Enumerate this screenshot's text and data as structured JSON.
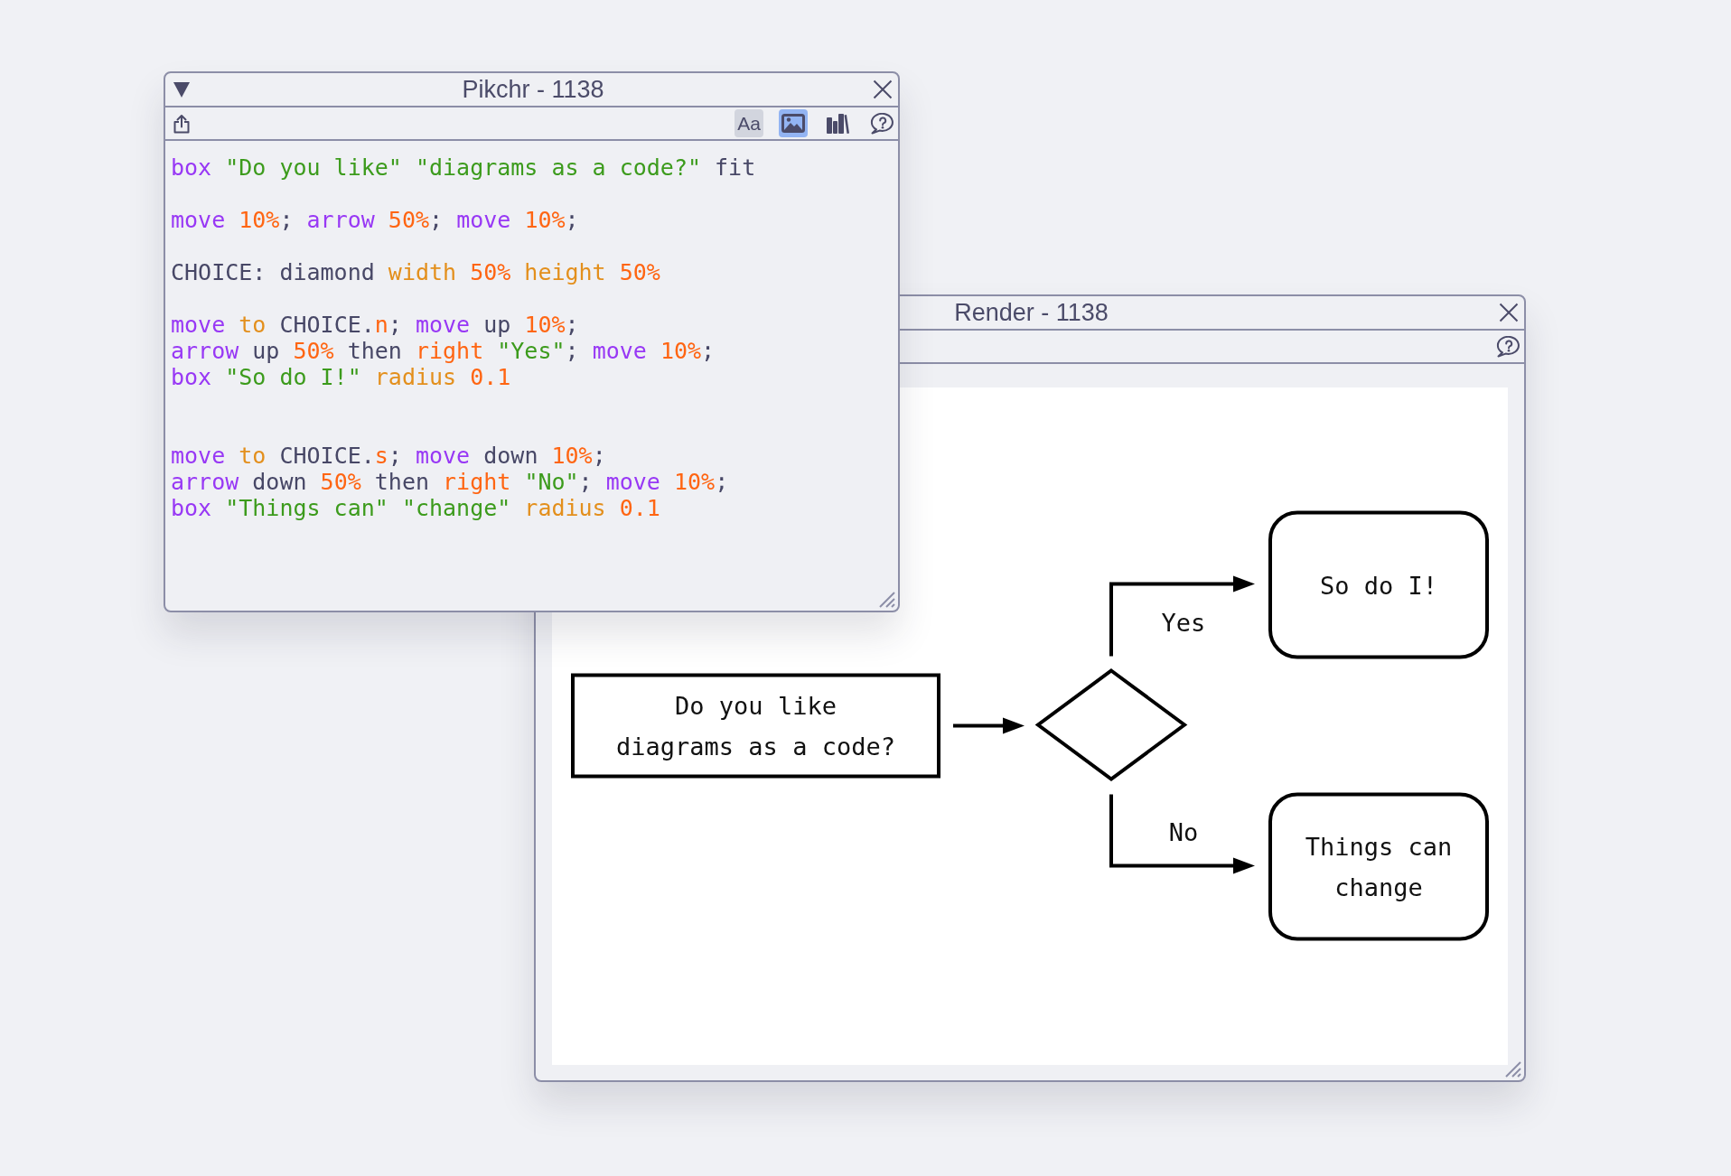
{
  "pikchr_window": {
    "title": "Pikchr - 1138",
    "menu_toggle": true,
    "toolbar": {
      "left": [
        {
          "kind": "share"
        }
      ],
      "right": [
        {
          "kind": "font",
          "label": "Aa",
          "on": true,
          "selected": false
        },
        {
          "kind": "image",
          "on": false,
          "selected": true
        },
        {
          "kind": "library",
          "on": false,
          "selected": false
        },
        {
          "kind": "help",
          "on": false,
          "selected": false
        }
      ]
    },
    "editor": {
      "lines": [
        {
          "kind": "code",
          "tokens": [
            {
              "kind": "keyword",
              "text": "box"
            },
            {
              "kind": "string",
              "text": " \"Do you like\""
            },
            {
              "kind": "string",
              "text": " \"diagrams as a code?\""
            },
            {
              "kind": "plain",
              "text": " fit"
            }
          ]
        },
        {
          "kind": "blank"
        },
        {
          "kind": "code",
          "tokens": [
            {
              "kind": "keyword",
              "text": "move"
            },
            {
              "kind": "number",
              "text": " 10%"
            },
            {
              "kind": "plain",
              "text": "; "
            },
            {
              "kind": "keyword",
              "text": "arrow"
            },
            {
              "kind": "number",
              "text": " 50%"
            },
            {
              "kind": "plain",
              "text": "; "
            },
            {
              "kind": "keyword",
              "text": "move"
            },
            {
              "kind": "number",
              "text": " 10%"
            },
            {
              "kind": "plain",
              "text": ";"
            }
          ]
        },
        {
          "kind": "blank"
        },
        {
          "kind": "code",
          "tokens": [
            {
              "kind": "plain",
              "text": "CHOICE: diamond"
            },
            {
              "kind": "property",
              "text": " width"
            },
            {
              "kind": "number",
              "text": " 50%"
            },
            {
              "kind": "property",
              "text": " height"
            },
            {
              "kind": "number",
              "text": " 50%"
            }
          ]
        },
        {
          "kind": "blank"
        },
        {
          "kind": "code",
          "tokens": [
            {
              "kind": "keyword",
              "text": "move"
            },
            {
              "kind": "property",
              "text": " to"
            },
            {
              "kind": "plain",
              "text": " CHOICE."
            },
            {
              "kind": "direction",
              "text": "n"
            },
            {
              "kind": "plain",
              "text": "; "
            },
            {
              "kind": "keyword",
              "text": "move"
            },
            {
              "kind": "plain",
              "text": " up"
            },
            {
              "kind": "number",
              "text": " 10%"
            },
            {
              "kind": "plain",
              "text": ";"
            }
          ]
        },
        {
          "kind": "code",
          "tokens": [
            {
              "kind": "keyword",
              "text": "arrow"
            },
            {
              "kind": "plain",
              "text": " up"
            },
            {
              "kind": "number",
              "text": " 50%"
            },
            {
              "kind": "plain",
              "text": " then"
            },
            {
              "kind": "direction",
              "text": " right"
            },
            {
              "kind": "string",
              "text": " \"Yes\""
            },
            {
              "kind": "plain",
              "text": "; "
            },
            {
              "kind": "keyword",
              "text": "move"
            },
            {
              "kind": "number",
              "text": " 10%"
            },
            {
              "kind": "plain",
              "text": ";"
            }
          ]
        },
        {
          "kind": "code",
          "tokens": [
            {
              "kind": "keyword",
              "text": "box"
            },
            {
              "kind": "string",
              "text": " \"So do I!\""
            },
            {
              "kind": "property",
              "text": " radius"
            },
            {
              "kind": "number",
              "text": " 0.1"
            }
          ]
        },
        {
          "kind": "blank"
        },
        {
          "kind": "blank"
        },
        {
          "kind": "code",
          "tokens": [
            {
              "kind": "keyword",
              "text": "move"
            },
            {
              "kind": "property",
              "text": " to"
            },
            {
              "kind": "plain",
              "text": " CHOICE."
            },
            {
              "kind": "direction",
              "text": "s"
            },
            {
              "kind": "plain",
              "text": "; "
            },
            {
              "kind": "keyword",
              "text": "move"
            },
            {
              "kind": "plain",
              "text": " down"
            },
            {
              "kind": "number",
              "text": " 10%"
            },
            {
              "kind": "plain",
              "text": ";"
            }
          ]
        },
        {
          "kind": "code",
          "tokens": [
            {
              "kind": "keyword",
              "text": "arrow"
            },
            {
              "kind": "plain",
              "text": " down"
            },
            {
              "kind": "number",
              "text": " 50%"
            },
            {
              "kind": "plain",
              "text": " then"
            },
            {
              "kind": "direction",
              "text": " right"
            },
            {
              "kind": "string",
              "text": " \"No\""
            },
            {
              "kind": "plain",
              "text": "; "
            },
            {
              "kind": "keyword",
              "text": "move"
            },
            {
              "kind": "number",
              "text": " 10%"
            },
            {
              "kind": "plain",
              "text": ";"
            }
          ]
        },
        {
          "kind": "code",
          "tokens": [
            {
              "kind": "keyword",
              "text": "box"
            },
            {
              "kind": "string",
              "text": " \"Things can\""
            },
            {
              "kind": "string",
              "text": " \"change\""
            },
            {
              "kind": "property",
              "text": " radius"
            },
            {
              "kind": "number",
              "text": " 0.1"
            }
          ]
        }
      ]
    }
  },
  "render_window": {
    "title": "Render - 1138",
    "toolbar": {
      "right": [
        {
          "kind": "help",
          "on": false,
          "selected": false
        }
      ]
    },
    "diagram": {
      "nodes": [
        {
          "kind": "box",
          "lines": [
            "Do you like",
            "diagrams as a code?"
          ]
        },
        {
          "kind": "diamond"
        },
        {
          "kind": "rounded-box",
          "lines": [
            "So do I!"
          ]
        },
        {
          "kind": "rounded-box",
          "lines": [
            "Things can",
            "change"
          ]
        }
      ],
      "edges": [
        {
          "kind": "straight"
        },
        {
          "kind": "elbow",
          "label": "Yes"
        },
        {
          "kind": "elbow",
          "label": "No"
        }
      ]
    }
  }
}
